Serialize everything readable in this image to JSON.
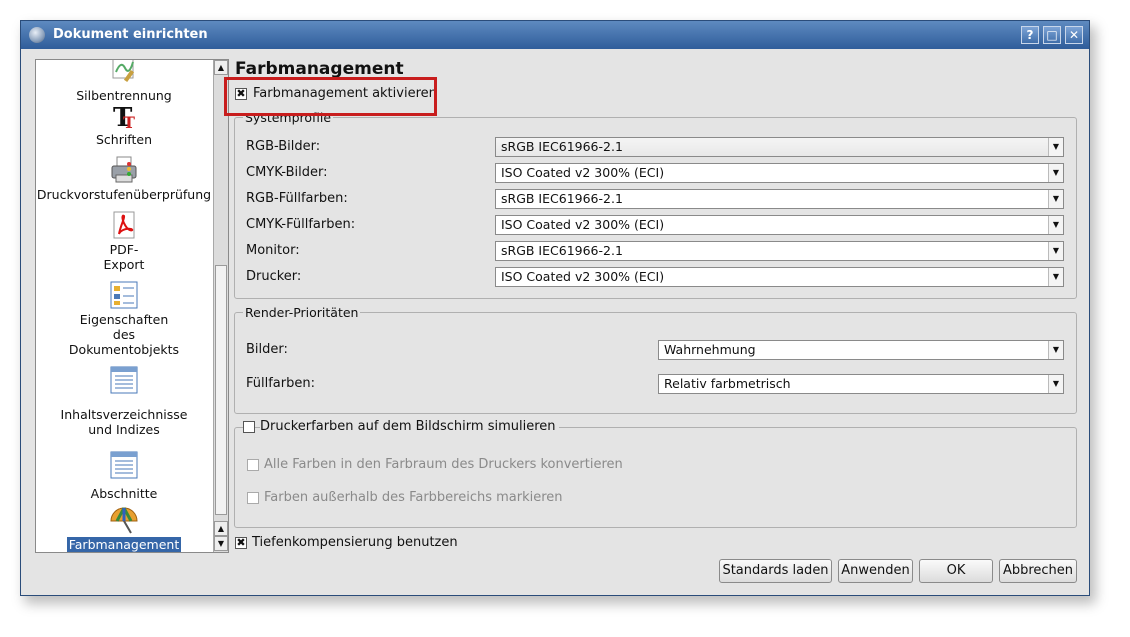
{
  "window": {
    "title": "Dokument einrichten",
    "help": "?",
    "maximize": "□",
    "close": "✕"
  },
  "sidebar": {
    "items": [
      {
        "label": "Silbentrennung",
        "icon": "hyphenation-icon"
      },
      {
        "label": "Schriften",
        "icon": "fonts-icon"
      },
      {
        "label": "Druckvorstufenüberprüfung",
        "icon": "preflight-printer-icon"
      },
      {
        "label_line1": "PDF-",
        "label_line2": "Export",
        "icon": "pdf-export-icon"
      },
      {
        "label_line1": "Eigenschaften",
        "label_line2": "des",
        "label_line3": "Dokumentobjekts",
        "icon": "document-properties-icon"
      },
      {
        "label_line1": "Inhaltsverzeichnisse",
        "label_line2": "und Indizes",
        "icon": "toc-icon"
      },
      {
        "label": "Abschnitte",
        "icon": "sections-icon"
      },
      {
        "label": "Farbmanagement",
        "icon": "color-management-icon",
        "selected": true
      }
    ]
  },
  "page": {
    "heading": "Farbmanagement",
    "enable_cm": {
      "label": "Farbmanagement aktivieren",
      "checked": true
    }
  },
  "systemprofile": {
    "legend": "Systemprofile",
    "rows": [
      {
        "label": "RGB-Bilder:",
        "value": "sRGB IEC61966-2.1"
      },
      {
        "label": "CMYK-Bilder:",
        "value": "ISO Coated v2 300% (ECI)"
      },
      {
        "label": "RGB-Füllfarben:",
        "value": "sRGB IEC61966-2.1"
      },
      {
        "label": "CMYK-Füllfarben:",
        "value": "ISO Coated v2 300% (ECI)"
      },
      {
        "label": "Monitor:",
        "value": "sRGB IEC61966-2.1"
      },
      {
        "label": "Drucker:",
        "value": "ISO Coated v2 300% (ECI)"
      }
    ]
  },
  "render": {
    "legend": "Render-Prioritäten",
    "rows": [
      {
        "label": "Bilder:",
        "value": "Wahrnehmung"
      },
      {
        "label": "Füllfarben:",
        "value": "Relativ farbmetrisch"
      }
    ]
  },
  "simulate": {
    "label": "Druckerfarben auf dem Bildschirm simulieren",
    "convert_label": "Alle Farben in den Farbraum des Druckers konvertieren",
    "mark_label": "Farben außerhalb des Farbbereichs markieren"
  },
  "tiefen": {
    "label": "Tiefenkompensierung benutzen",
    "checked": true
  },
  "buttons": {
    "defaults": "Standards laden",
    "apply": "Anwenden",
    "ok": "OK",
    "cancel": "Abbrechen"
  },
  "colors": {
    "titlebar": "#3a6aa6",
    "annotation_box": "#c81d1d",
    "selection": "#3566a8"
  }
}
